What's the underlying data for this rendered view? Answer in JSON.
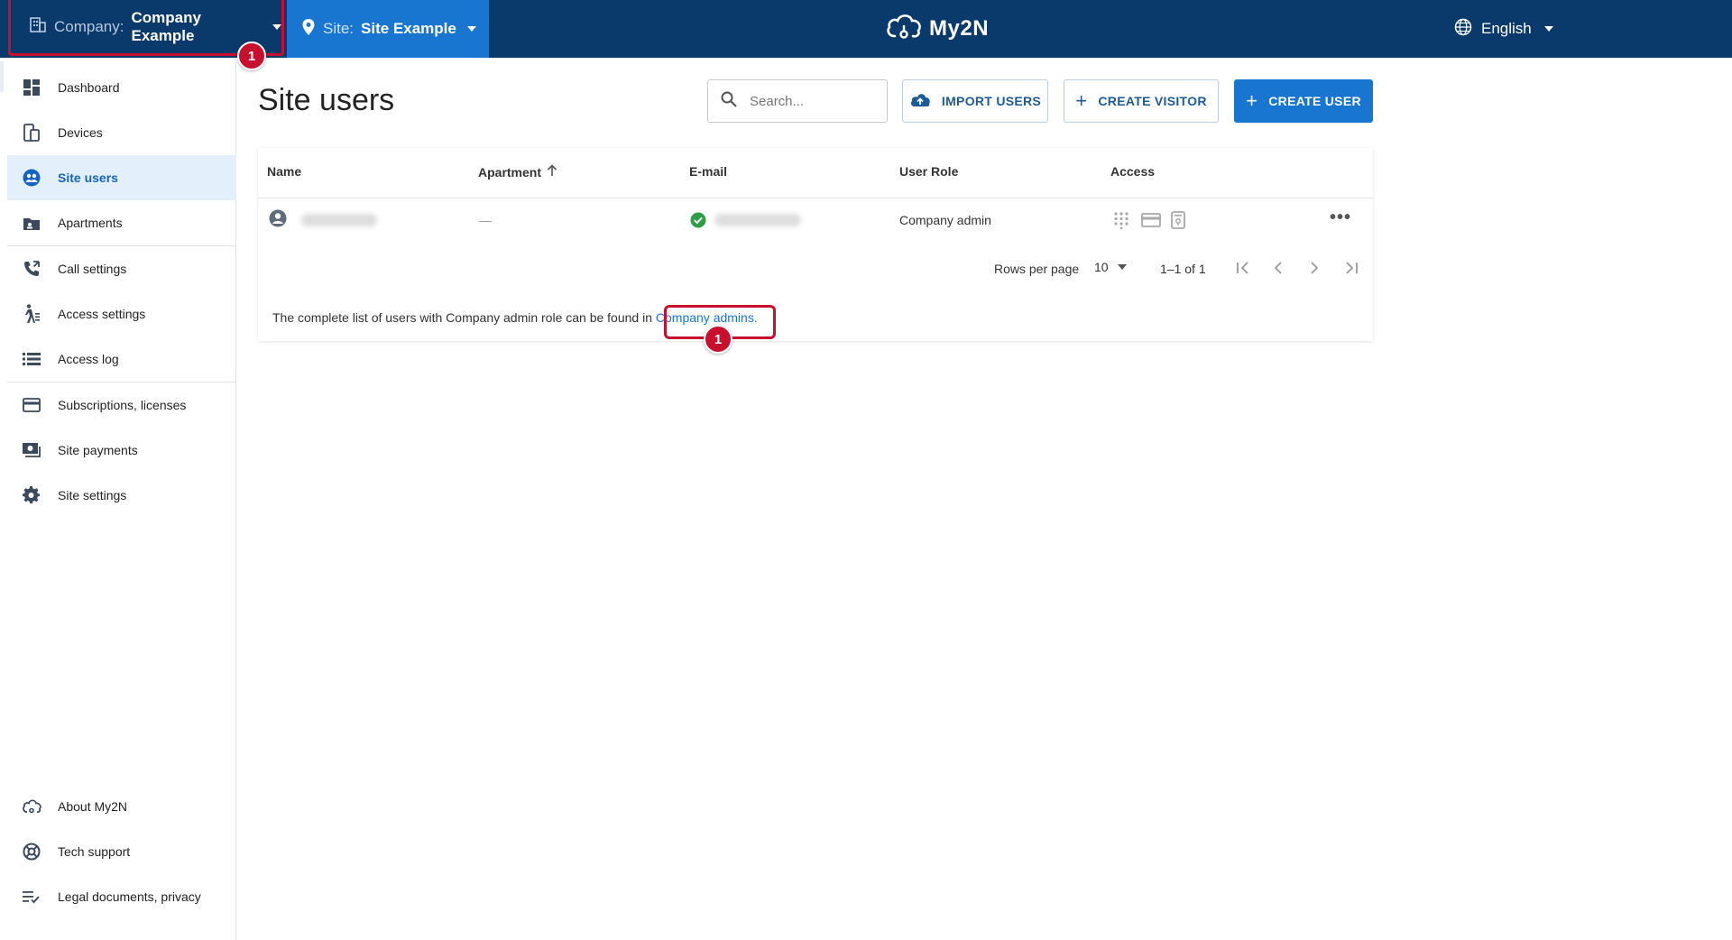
{
  "topbar": {
    "company_label": "Company:",
    "company_value": "Company Example",
    "site_label": "Site:",
    "site_value": "Site Example",
    "logo_text": "My2N",
    "language": "English",
    "annotation_number": "1"
  },
  "sidebar": {
    "items": [
      {
        "label": "Dashboard",
        "icon": "dashboard-icon"
      },
      {
        "label": "Devices",
        "icon": "devices-icon"
      },
      {
        "label": "Site users",
        "icon": "users-icon",
        "active": true
      },
      {
        "label": "Apartments",
        "icon": "apartment-icon"
      },
      {
        "label": "Call settings",
        "icon": "phone-icon"
      },
      {
        "label": "Access settings",
        "icon": "walk-icon"
      },
      {
        "label": "Access log",
        "icon": "list-icon"
      },
      {
        "label": "Subscriptions, licenses",
        "icon": "card-icon"
      },
      {
        "label": "Site payments",
        "icon": "payments-icon"
      },
      {
        "label": "Site settings",
        "icon": "gear-icon"
      }
    ],
    "footer_items": [
      {
        "label": "About My2N",
        "icon": "cloud-icon"
      },
      {
        "label": "Tech support",
        "icon": "support-icon"
      },
      {
        "label": "Legal documents, privacy",
        "icon": "legal-icon"
      }
    ]
  },
  "main": {
    "title": "Site users",
    "search_placeholder": "Search...",
    "buttons": {
      "import": "IMPORT USERS",
      "visitor": "CREATE VISITOR",
      "user": "CREATE USER"
    },
    "table": {
      "columns": [
        "Name",
        "Apartment",
        "E-mail",
        "User Role",
        "Access"
      ],
      "rows": [
        {
          "name": "",
          "apartment": "—",
          "email": "",
          "role": "Company admin"
        }
      ]
    },
    "pagination": {
      "rows_per_page_label": "Rows per page",
      "rows_per_page_value": "10",
      "range": "1–1 of 1"
    },
    "note": {
      "text": "The complete list of users with Company admin role can be found in",
      "link": "Company admins.",
      "annotation_number": "1"
    }
  },
  "colors": {
    "topbar": "#0a3a6b",
    "site_accent": "#1876d1",
    "annotation": "#c8102e",
    "active_nav_bg": "#e3f0fb"
  }
}
